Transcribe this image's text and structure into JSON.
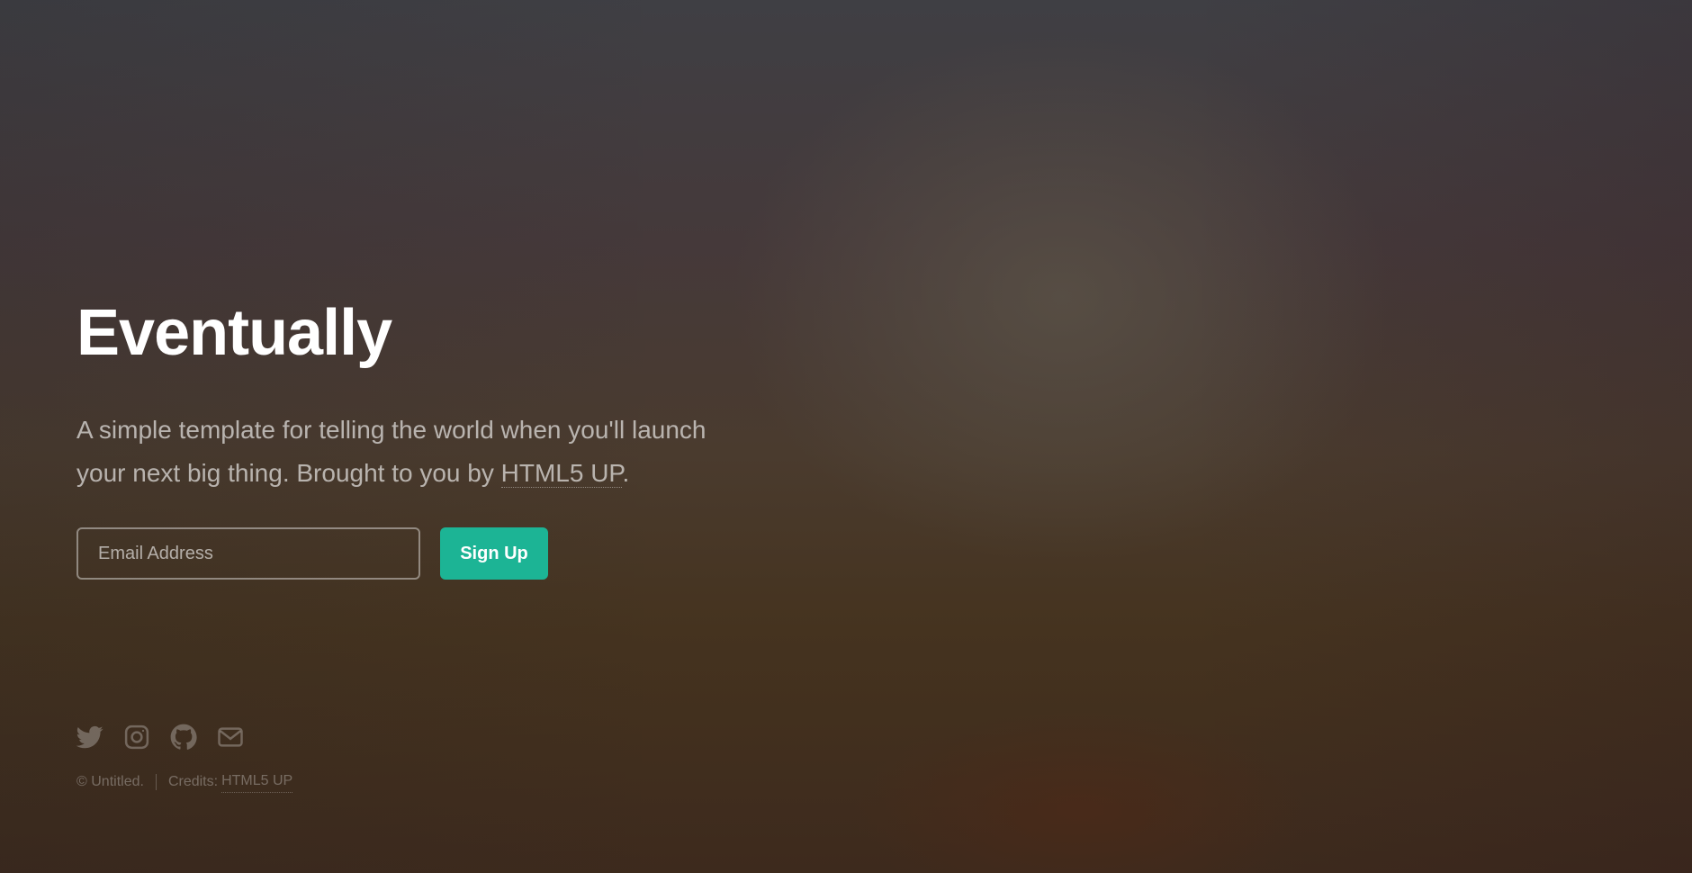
{
  "header": {
    "title": "Eventually",
    "tagline_before": "A simple template for telling the world when you'll launch your next big thing. Brought to you by ",
    "tagline_link": "HTML5 UP",
    "tagline_after": "."
  },
  "signup_form": {
    "email_placeholder": "Email Address",
    "submit_label": "Sign Up"
  },
  "social_icons": [
    "twitter-icon",
    "instagram-icon",
    "github-icon",
    "envelope-icon"
  ],
  "footer": {
    "copyright": "© Untitled.",
    "credits_label": "Credits:",
    "credits_link": "HTML5 UP"
  },
  "colors": {
    "accent": "#1cb495",
    "text": "#ffffff"
  }
}
